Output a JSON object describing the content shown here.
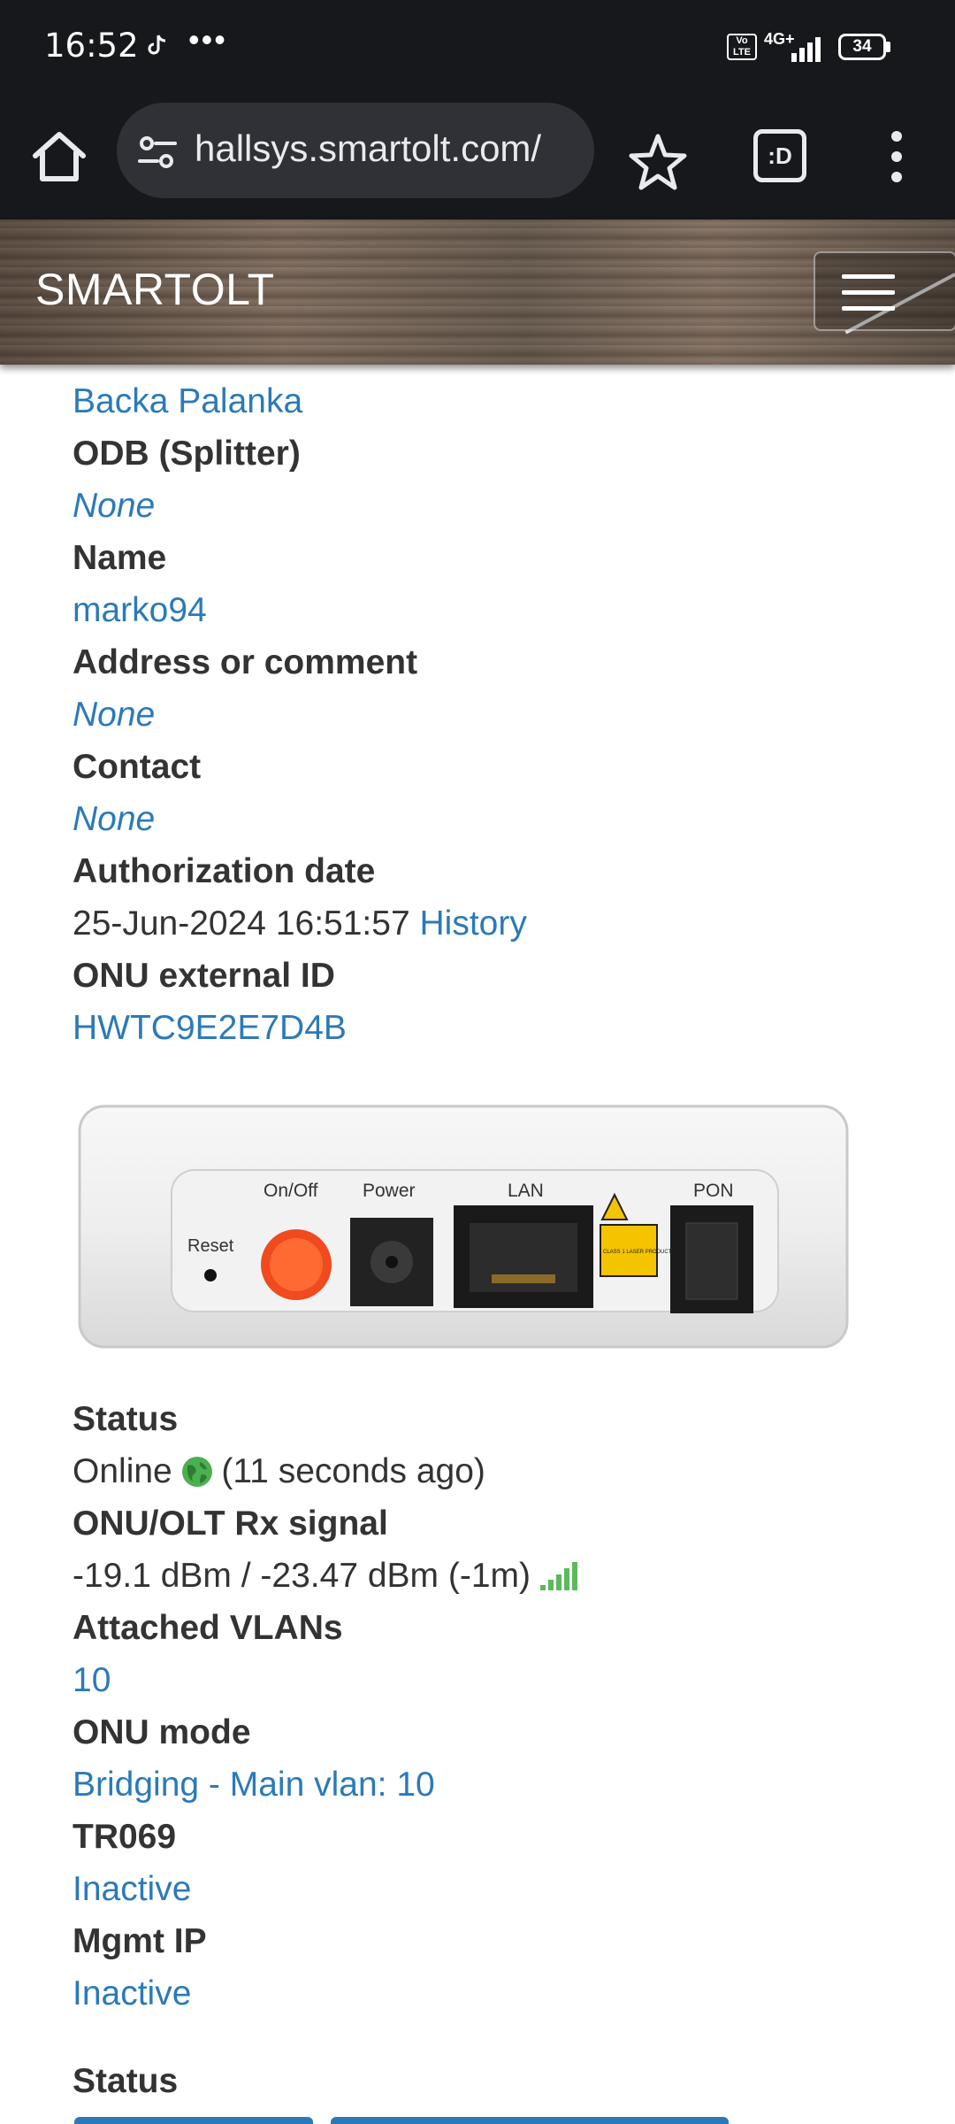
{
  "status_bar": {
    "time": "16:52",
    "more_indicator": "•••",
    "volte": "Vo LTE",
    "network": "4G+",
    "battery": "34"
  },
  "browser": {
    "url": "hallsys.smartolt.com/",
    "tabs_label": ":D"
  },
  "navbar": {
    "brand": "SMARTOLT"
  },
  "details": {
    "zone_value": "Backa Palanka",
    "odb_label": "ODB (Splitter)",
    "odb_value": "None",
    "name_label": "Name",
    "name_value": "marko94",
    "address_label": "Address or comment",
    "address_value": "None",
    "contact_label": "Contact",
    "contact_value": "None",
    "auth_date_label": "Authorization date",
    "auth_date_value": "25-Jun-2024 16:51:57",
    "history_link": "History",
    "ext_id_label": "ONU external ID",
    "ext_id_value": "HWTC9E2E7D4B"
  },
  "device_photo": {
    "labels": {
      "reset": "Reset",
      "onoff": "On/Off",
      "power": "Power",
      "lan": "LAN",
      "pon": "PON",
      "laser_warning": "CLASS 1 LASER PRODUCT"
    }
  },
  "status_section": {
    "status_label": "Status",
    "status_value": "Online",
    "status_ago": "(11 seconds ago)",
    "signal_label": "ONU/OLT Rx signal",
    "signal_value": "-19.1 dBm / -23.47 dBm (-1m)",
    "vlans_label": "Attached VLANs",
    "vlans_value": "10",
    "mode_label": "ONU mode",
    "mode_value": "Bridging - Main vlan: 10",
    "tr069_label": "TR069",
    "tr069_value": "Inactive",
    "mgmt_label": "Mgmt IP",
    "mgmt_value": "Inactive",
    "bottom_heading": "Status"
  },
  "colors": {
    "link": "#2b7ab8",
    "online": "#4caf50",
    "chrome_bg": "#17181c"
  }
}
